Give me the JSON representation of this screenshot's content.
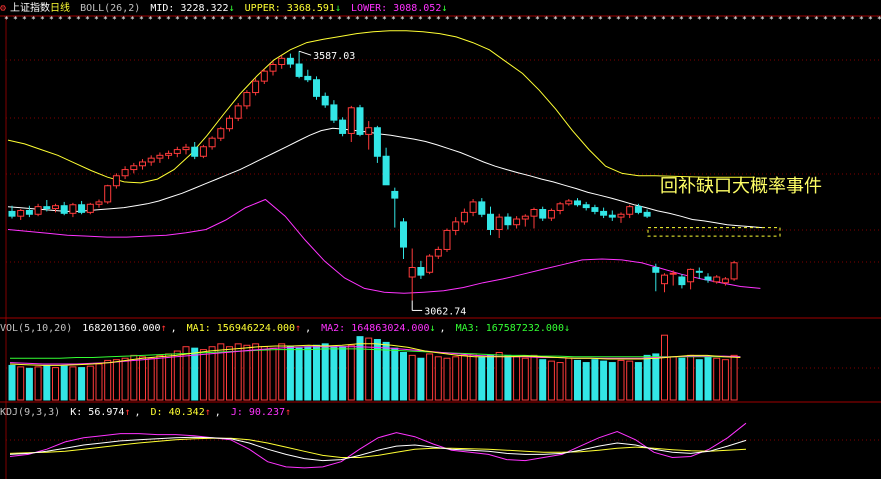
{
  "header": {
    "index_name": "上证指数",
    "period": "日线",
    "boll_label": "BOLL(26,2)",
    "mid": "MID: 3228.322",
    "upper": "UPPER: 3368.591",
    "lower": "LOWER: 3088.052"
  },
  "vol_header": {
    "label": "VOL(5,10,20)",
    "value": "168201360.000",
    "ma1": "MA1: 156946224.000",
    "ma2": "MA2: 164863024.000",
    "ma3": "MA3: 167587232.000"
  },
  "kdj_header": {
    "label": "KDJ(9,3,3)",
    "k": "K: 56.974",
    "d": "D: 40.342",
    "j": "J: 90.237"
  },
  "annotations": {
    "high_label": "3587.03",
    "low_label": "3062.74",
    "note": "回补缺口大概率事件"
  },
  "colors": {
    "up": "#ff3b3b",
    "down": "#33e6e6",
    "mid": "#ffffff",
    "upper": "#ffff33",
    "lower": "#ff33ff",
    "ma2": "#ff33ff",
    "ma3": "#33ff33",
    "grid": "#800000"
  },
  "chart_data": [
    {
      "type": "candlestick",
      "title": "上证指数 日线",
      "ylim": [
        3030,
        3640
      ],
      "candles": [
        {
          "o": 3250,
          "h": 3262,
          "l": 3235,
          "c": 3240
        },
        {
          "o": 3240,
          "h": 3255,
          "l": 3232,
          "c": 3252
        },
        {
          "o": 3252,
          "h": 3262,
          "l": 3238,
          "c": 3244
        },
        {
          "o": 3244,
          "h": 3266,
          "l": 3240,
          "c": 3260
        },
        {
          "o": 3260,
          "h": 3274,
          "l": 3250,
          "c": 3256
        },
        {
          "o": 3256,
          "h": 3266,
          "l": 3248,
          "c": 3262
        },
        {
          "o": 3262,
          "h": 3270,
          "l": 3242,
          "c": 3246
        },
        {
          "o": 3246,
          "h": 3268,
          "l": 3238,
          "c": 3264
        },
        {
          "o": 3264,
          "h": 3272,
          "l": 3244,
          "c": 3248
        },
        {
          "o": 3248,
          "h": 3268,
          "l": 3244,
          "c": 3265
        },
        {
          "o": 3265,
          "h": 3275,
          "l": 3258,
          "c": 3270
        },
        {
          "o": 3270,
          "h": 3306,
          "l": 3266,
          "c": 3304
        },
        {
          "o": 3304,
          "h": 3330,
          "l": 3298,
          "c": 3325
        },
        {
          "o": 3325,
          "h": 3345,
          "l": 3318,
          "c": 3338
        },
        {
          "o": 3338,
          "h": 3352,
          "l": 3330,
          "c": 3346
        },
        {
          "o": 3346,
          "h": 3360,
          "l": 3338,
          "c": 3354
        },
        {
          "o": 3354,
          "h": 3368,
          "l": 3346,
          "c": 3362
        },
        {
          "o": 3362,
          "h": 3374,
          "l": 3352,
          "c": 3368
        },
        {
          "o": 3368,
          "h": 3378,
          "l": 3360,
          "c": 3372
        },
        {
          "o": 3372,
          "h": 3386,
          "l": 3364,
          "c": 3380
        },
        {
          "o": 3380,
          "h": 3392,
          "l": 3370,
          "c": 3385
        },
        {
          "o": 3385,
          "h": 3396,
          "l": 3360,
          "c": 3366
        },
        {
          "o": 3366,
          "h": 3390,
          "l": 3362,
          "c": 3386
        },
        {
          "o": 3386,
          "h": 3408,
          "l": 3380,
          "c": 3404
        },
        {
          "o": 3404,
          "h": 3428,
          "l": 3398,
          "c": 3424
        },
        {
          "o": 3424,
          "h": 3452,
          "l": 3418,
          "c": 3446
        },
        {
          "o": 3446,
          "h": 3478,
          "l": 3440,
          "c": 3472
        },
        {
          "o": 3472,
          "h": 3505,
          "l": 3465,
          "c": 3500
        },
        {
          "o": 3500,
          "h": 3530,
          "l": 3494,
          "c": 3524
        },
        {
          "o": 3524,
          "h": 3550,
          "l": 3518,
          "c": 3545
        },
        {
          "o": 3545,
          "h": 3566,
          "l": 3536,
          "c": 3559
        },
        {
          "o": 3559,
          "h": 3578,
          "l": 3550,
          "c": 3572
        },
        {
          "o": 3572,
          "h": 3582,
          "l": 3552,
          "c": 3560
        },
        {
          "o": 3560,
          "h": 3587,
          "l": 3530,
          "c": 3534
        },
        {
          "o": 3534,
          "h": 3548,
          "l": 3522,
          "c": 3527
        },
        {
          "o": 3527,
          "h": 3534,
          "l": 3485,
          "c": 3492
        },
        {
          "o": 3492,
          "h": 3500,
          "l": 3468,
          "c": 3474
        },
        {
          "o": 3474,
          "h": 3484,
          "l": 3436,
          "c": 3442
        },
        {
          "o": 3442,
          "h": 3448,
          "l": 3408,
          "c": 3414
        },
        {
          "o": 3414,
          "h": 3472,
          "l": 3396,
          "c": 3468
        },
        {
          "o": 3468,
          "h": 3474,
          "l": 3408,
          "c": 3412
        },
        {
          "o": 3412,
          "h": 3440,
          "l": 3380,
          "c": 3426
        },
        {
          "o": 3426,
          "h": 3430,
          "l": 3352,
          "c": 3366
        },
        {
          "o": 3366,
          "h": 3384,
          "l": 3310,
          "c": 3306
        },
        {
          "o": 3292,
          "h": 3300,
          "l": 3216,
          "c": 3278
        },
        {
          "o": 3228,
          "h": 3236,
          "l": 3150,
          "c": 3175
        },
        {
          "o": 3112,
          "h": 3172,
          "l": 3063,
          "c": 3132
        },
        {
          "o": 3132,
          "h": 3146,
          "l": 3108,
          "c": 3116
        },
        {
          "o": 3122,
          "h": 3160,
          "l": 3118,
          "c": 3156
        },
        {
          "o": 3156,
          "h": 3176,
          "l": 3150,
          "c": 3170
        },
        {
          "o": 3170,
          "h": 3214,
          "l": 3165,
          "c": 3210
        },
        {
          "o": 3210,
          "h": 3238,
          "l": 3200,
          "c": 3228
        },
        {
          "o": 3228,
          "h": 3256,
          "l": 3222,
          "c": 3248
        },
        {
          "o": 3248,
          "h": 3276,
          "l": 3240,
          "c": 3270
        },
        {
          "o": 3270,
          "h": 3278,
          "l": 3238,
          "c": 3244
        },
        {
          "o": 3244,
          "h": 3260,
          "l": 3200,
          "c": 3212
        },
        {
          "o": 3212,
          "h": 3245,
          "l": 3194,
          "c": 3238
        },
        {
          "o": 3238,
          "h": 3246,
          "l": 3212,
          "c": 3222
        },
        {
          "o": 3222,
          "h": 3240,
          "l": 3214,
          "c": 3234
        },
        {
          "o": 3234,
          "h": 3244,
          "l": 3218,
          "c": 3240
        },
        {
          "o": 3240,
          "h": 3258,
          "l": 3214,
          "c": 3254
        },
        {
          "o": 3254,
          "h": 3260,
          "l": 3230,
          "c": 3236
        },
        {
          "o": 3236,
          "h": 3256,
          "l": 3230,
          "c": 3252
        },
        {
          "o": 3252,
          "h": 3270,
          "l": 3244,
          "c": 3266
        },
        {
          "o": 3266,
          "h": 3276,
          "l": 3262,
          "c": 3272
        },
        {
          "o": 3272,
          "h": 3278,
          "l": 3260,
          "c": 3264
        },
        {
          "o": 3264,
          "h": 3270,
          "l": 3252,
          "c": 3258
        },
        {
          "o": 3258,
          "h": 3264,
          "l": 3244,
          "c": 3250
        },
        {
          "o": 3250,
          "h": 3258,
          "l": 3236,
          "c": 3242
        },
        {
          "o": 3242,
          "h": 3252,
          "l": 3230,
          "c": 3238
        },
        {
          "o": 3238,
          "h": 3248,
          "l": 3226,
          "c": 3244
        },
        {
          "o": 3244,
          "h": 3264,
          "l": 3236,
          "c": 3260
        },
        {
          "o": 3260,
          "h": 3266,
          "l": 3244,
          "c": 3248
        },
        {
          "o": 3248,
          "h": 3254,
          "l": 3236,
          "c": 3240
        },
        {
          "o": 3132,
          "h": 3140,
          "l": 3082,
          "c": 3122
        },
        {
          "o": 3098,
          "h": 3120,
          "l": 3080,
          "c": 3116
        },
        {
          "o": 3118,
          "h": 3126,
          "l": 3094,
          "c": 3120
        },
        {
          "o": 3112,
          "h": 3118,
          "l": 3088,
          "c": 3096
        },
        {
          "o": 3102,
          "h": 3130,
          "l": 3086,
          "c": 3128
        },
        {
          "o": 3124,
          "h": 3132,
          "l": 3108,
          "c": 3122
        },
        {
          "o": 3112,
          "h": 3120,
          "l": 3100,
          "c": 3106
        },
        {
          "o": 3102,
          "h": 3116,
          "l": 3098,
          "c": 3112
        },
        {
          "o": 3100,
          "h": 3112,
          "l": 3094,
          "c": 3108
        },
        {
          "o": 3108,
          "h": 3146,
          "l": 3104,
          "c": 3142
        }
      ],
      "mid": [
        3260,
        3258,
        3256,
        3254,
        3252,
        3250,
        3250,
        3252,
        3254,
        3256,
        3258,
        3262,
        3266,
        3272,
        3280,
        3288,
        3298,
        3308,
        3318,
        3328,
        3338,
        3350,
        3362,
        3374,
        3386,
        3398,
        3410,
        3420,
        3425,
        3423,
        3420,
        3417,
        3413,
        3410,
        3406,
        3402,
        3397,
        3390,
        3382,
        3374,
        3364,
        3354,
        3345,
        3338,
        3331,
        3325,
        3318,
        3312,
        3305,
        3298,
        3290,
        3284,
        3278,
        3271,
        3264,
        3258,
        3251,
        3246,
        3240,
        3233,
        3230,
        3226,
        3222,
        3220,
        3218,
        3216
      ],
      "upper": [
        3400,
        3392,
        3380,
        3368,
        3352,
        3336,
        3322,
        3312,
        3310,
        3318,
        3338,
        3370,
        3410,
        3455,
        3498,
        3535,
        3568,
        3590,
        3605,
        3612,
        3618,
        3624,
        3628,
        3630,
        3630,
        3628,
        3624,
        3617,
        3605,
        3590,
        3565,
        3540,
        3505,
        3465,
        3420,
        3380,
        3345,
        3330,
        3325,
        3325,
        3324,
        3323,
        3322,
        3322,
        3322,
        3322
      ],
      "lower": [
        3212,
        3208,
        3204,
        3200,
        3198,
        3196,
        3196,
        3198,
        3200,
        3205,
        3212,
        3232,
        3258,
        3275,
        3240,
        3190,
        3145,
        3110,
        3088,
        3080,
        3078,
        3080,
        3083,
        3090,
        3100,
        3108,
        3118,
        3128,
        3138,
        3148,
        3150,
        3148,
        3142,
        3130,
        3118,
        3108,
        3100,
        3092,
        3088
      ],
      "high_label_value": 3587.03,
      "low_label_value": 3062.74,
      "gap_box": [
        3198,
        3216
      ]
    },
    {
      "type": "bar",
      "title": "VOL(5,10,20)",
      "values": [
        0.48,
        0.46,
        0.44,
        0.46,
        0.48,
        0.45,
        0.47,
        0.46,
        0.45,
        0.47,
        0.5,
        0.55,
        0.56,
        0.58,
        0.62,
        0.6,
        0.58,
        0.62,
        0.64,
        0.68,
        0.74,
        0.72,
        0.7,
        0.74,
        0.78,
        0.74,
        0.78,
        0.76,
        0.78,
        0.74,
        0.72,
        0.78,
        0.75,
        0.72,
        0.74,
        0.76,
        0.78,
        0.74,
        0.74,
        0.76,
        0.88,
        0.86,
        0.84,
        0.8,
        0.72,
        0.66,
        0.62,
        0.58,
        0.64,
        0.6,
        0.58,
        0.6,
        0.62,
        0.64,
        0.6,
        0.62,
        0.66,
        0.62,
        0.6,
        0.58,
        0.62,
        0.56,
        0.54,
        0.52,
        0.58,
        0.55,
        0.52,
        0.56,
        0.54,
        0.52,
        0.55,
        0.54,
        0.52,
        0.62,
        0.64,
        0.9,
        0.6,
        0.58,
        0.62,
        0.56,
        0.6,
        0.58,
        0.56,
        0.62
      ],
      "ma1": [
        0.5,
        0.49,
        0.48,
        0.48,
        0.49,
        0.5,
        0.52,
        0.55,
        0.58,
        0.6,
        0.62,
        0.65,
        0.68,
        0.7,
        0.72,
        0.74,
        0.75,
        0.75,
        0.76,
        0.75,
        0.76,
        0.78,
        0.78,
        0.76,
        0.73,
        0.68,
        0.65,
        0.62,
        0.6,
        0.6,
        0.6,
        0.61,
        0.6,
        0.59,
        0.58,
        0.58,
        0.57,
        0.57,
        0.57,
        0.58,
        0.6,
        0.62,
        0.62,
        0.6,
        0.59
      ],
      "ma2": [
        0.52,
        0.51,
        0.5,
        0.5,
        0.5,
        0.51,
        0.52,
        0.54,
        0.56,
        0.58,
        0.6,
        0.62,
        0.64,
        0.66,
        0.68,
        0.7,
        0.72,
        0.73,
        0.74,
        0.74,
        0.74,
        0.74,
        0.73,
        0.72,
        0.7,
        0.68,
        0.66,
        0.64,
        0.62,
        0.61,
        0.6,
        0.6,
        0.59,
        0.59,
        0.58,
        0.58,
        0.58,
        0.58,
        0.58,
        0.59,
        0.6,
        0.61,
        0.61,
        0.61,
        0.6
      ],
      "ma3": [
        0.58,
        0.58,
        0.58,
        0.58,
        0.59,
        0.59,
        0.6,
        0.61,
        0.62,
        0.63,
        0.64,
        0.65,
        0.66,
        0.67,
        0.68,
        0.69,
        0.7,
        0.7,
        0.7,
        0.71,
        0.71,
        0.71,
        0.7,
        0.69,
        0.68,
        0.67,
        0.66,
        0.65,
        0.64,
        0.63,
        0.62,
        0.62,
        0.61,
        0.61,
        0.6,
        0.6,
        0.6,
        0.6,
        0.6,
        0.6,
        0.6,
        0.6,
        0.6,
        0.6,
        0.6
      ]
    },
    {
      "type": "line",
      "title": "KDJ(9,3,3)",
      "ylim": [
        0,
        100
      ],
      "K": [
        30,
        32,
        36,
        42,
        48,
        52,
        56,
        58,
        60,
        62,
        63,
        62,
        60,
        52,
        40,
        30,
        22,
        18,
        20,
        28,
        38,
        46,
        48,
        44,
        40,
        38,
        36,
        32,
        30,
        30,
        32,
        38,
        46,
        52,
        48,
        40,
        34,
        32,
        36,
        46,
        57
      ],
      "D": [
        32,
        33,
        34,
        36,
        40,
        44,
        48,
        52,
        55,
        58,
        60,
        61,
        61,
        58,
        52,
        44,
        36,
        28,
        24,
        24,
        28,
        34,
        40,
        42,
        42,
        41,
        40,
        38,
        36,
        34,
        34,
        35,
        38,
        42,
        44,
        42,
        39,
        37,
        36,
        38,
        40
      ],
      "J": [
        26,
        30,
        40,
        54,
        62,
        66,
        70,
        70,
        68,
        68,
        66,
        62,
        58,
        40,
        16,
        6,
        4,
        6,
        16,
        40,
        62,
        72,
        64,
        50,
        38,
        34,
        30,
        20,
        18,
        24,
        30,
        46,
        62,
        74,
        58,
        34,
        24,
        26,
        40,
        62,
        90
      ]
    }
  ]
}
